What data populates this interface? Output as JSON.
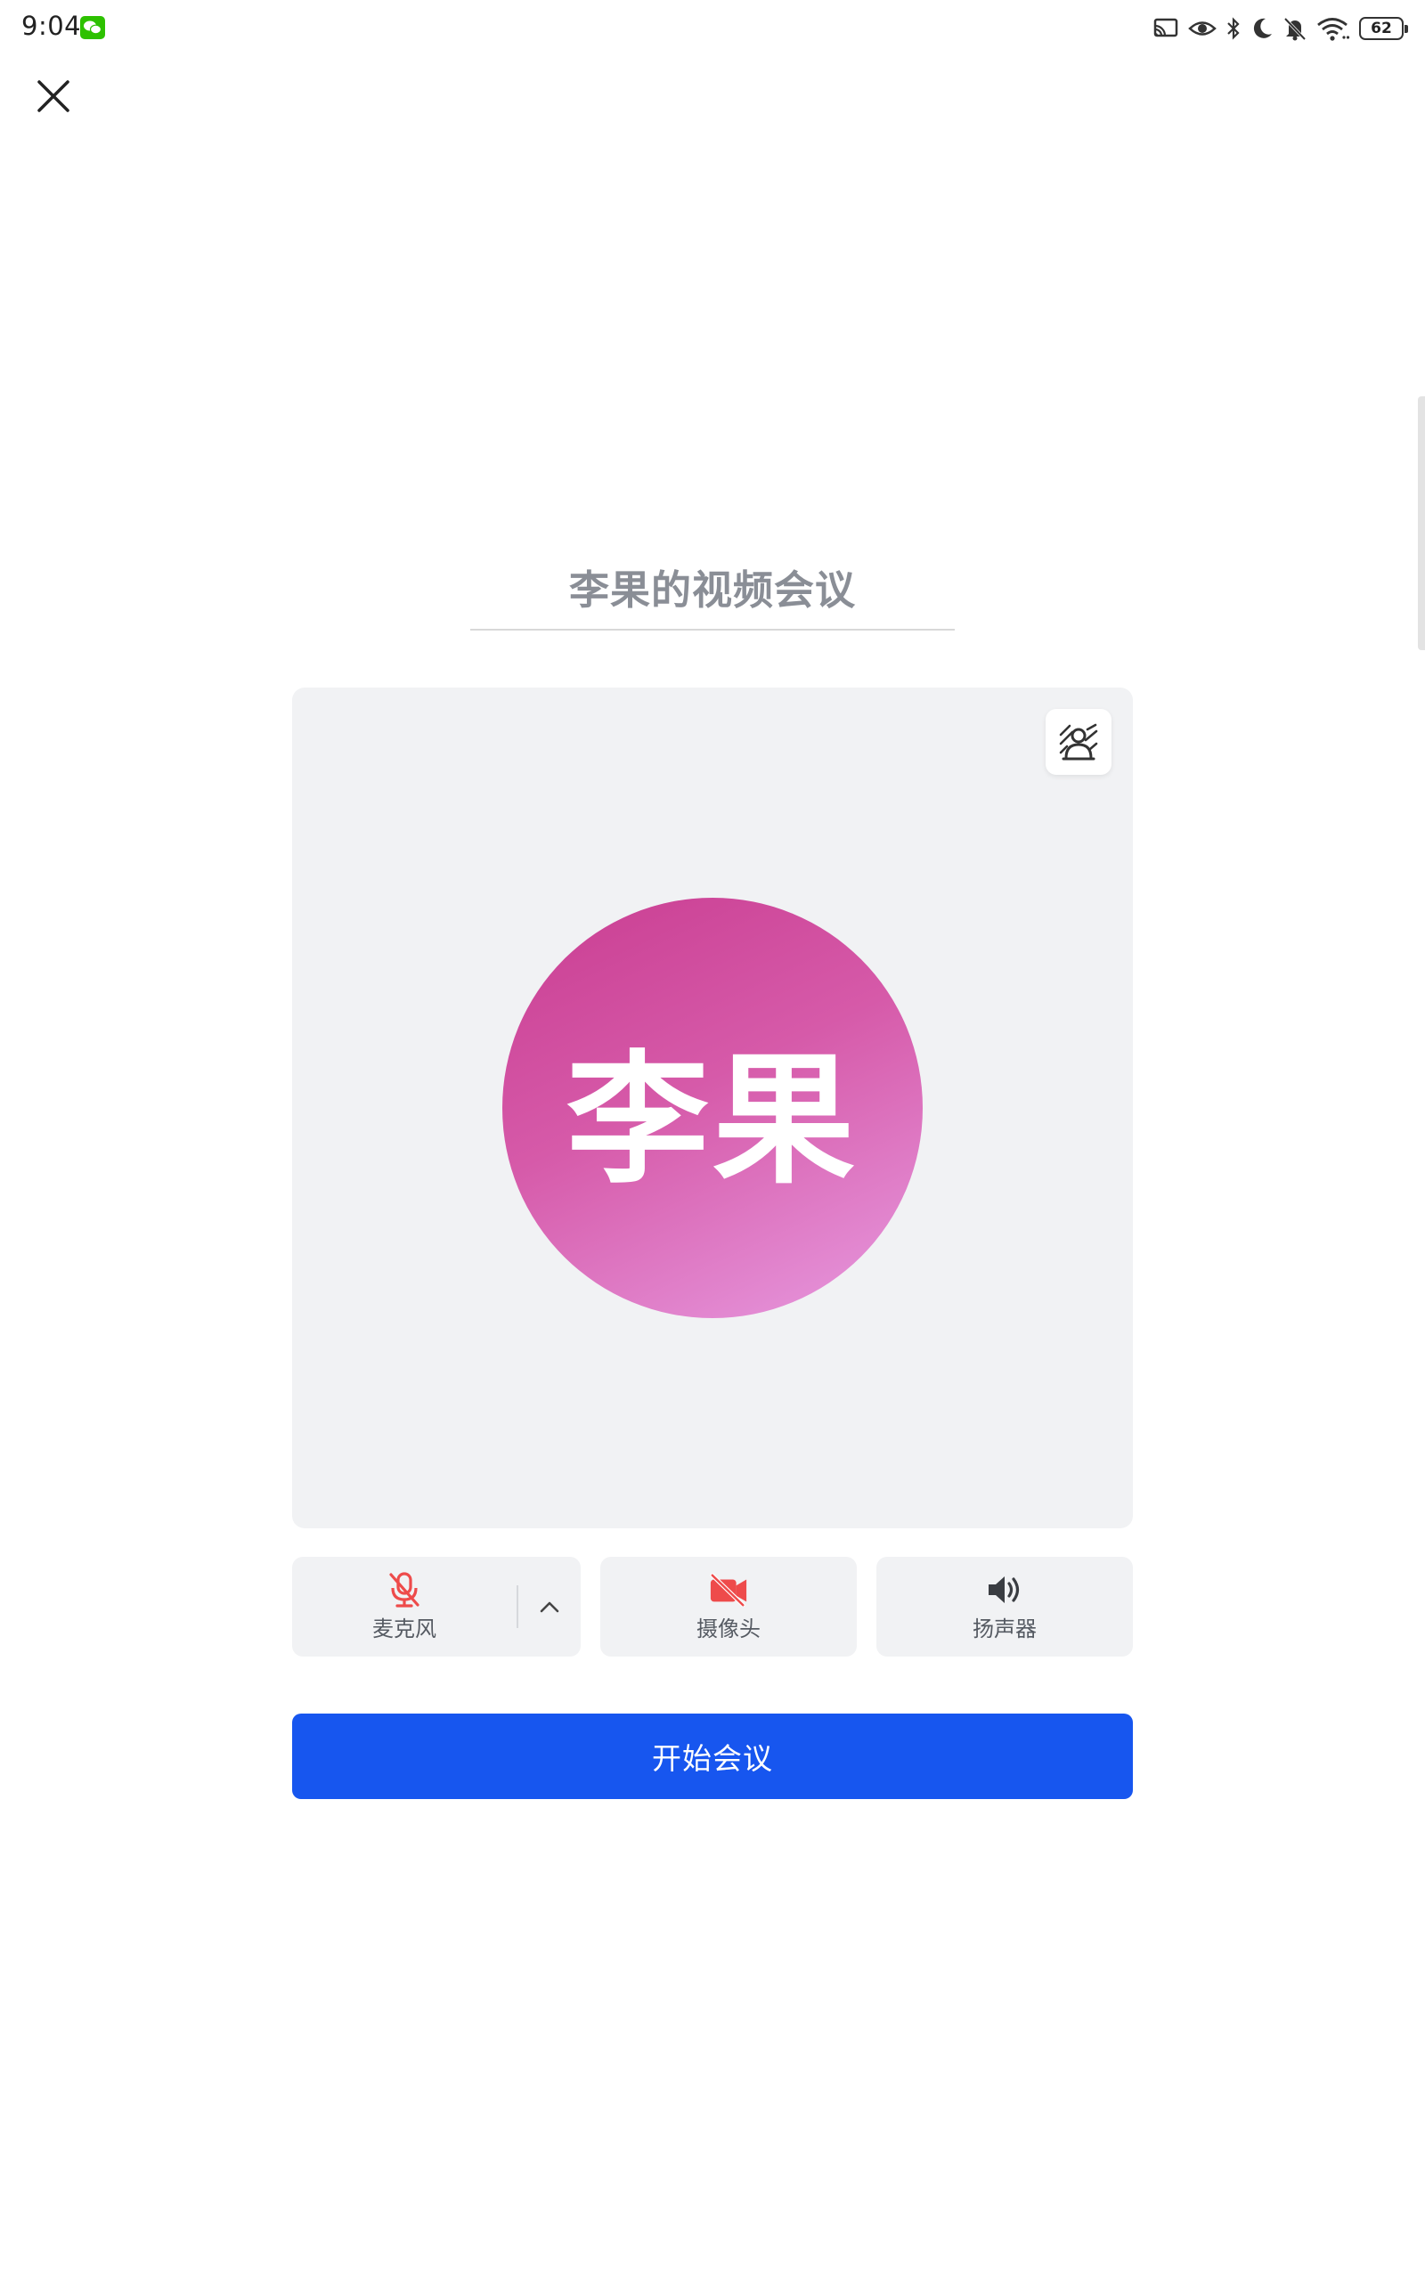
{
  "status_bar": {
    "time": "9:04",
    "battery": "62",
    "icons": [
      "wechat-icon",
      "cast-icon",
      "eye-icon",
      "bluetooth-icon",
      "moon-icon",
      "mute-bell-icon",
      "wifi-icon",
      "battery-icon"
    ]
  },
  "header": {
    "close_icon": "close-icon"
  },
  "meeting": {
    "title": "李果的视频会议"
  },
  "preview": {
    "avatar_text": "李果",
    "avatar_gradient": [
      "#c93d91",
      "#e79ae0"
    ],
    "background_button_icon": "virtual-background-icon"
  },
  "controls": {
    "mic_label": "麦克风",
    "mic_state": "muted",
    "camera_label": "摄像头",
    "camera_state": "off",
    "speaker_label": "扬声器",
    "speaker_state": "on",
    "off_color": "#ee4b4b"
  },
  "actions": {
    "start_label": "开始会议",
    "start_color": "#1756ef"
  }
}
